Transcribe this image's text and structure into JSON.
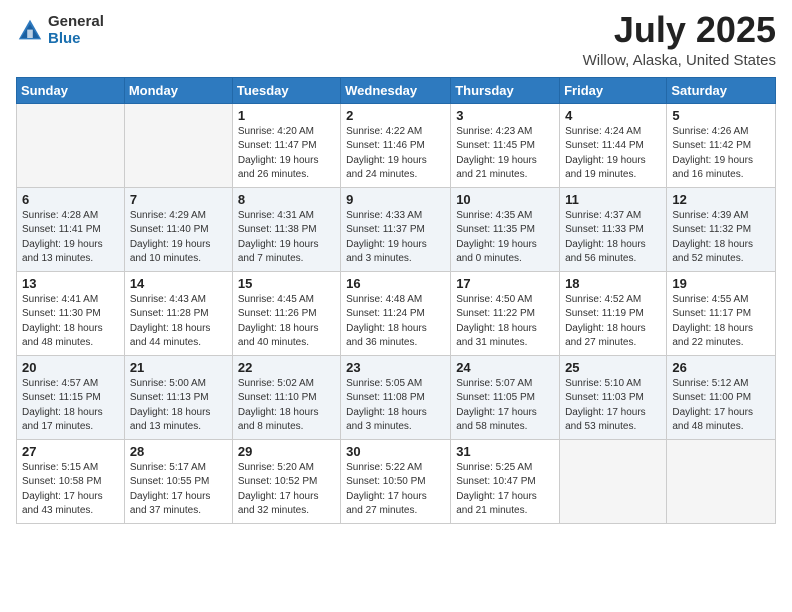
{
  "header": {
    "logo_general": "General",
    "logo_blue": "Blue",
    "title": "July 2025",
    "location": "Willow, Alaska, United States"
  },
  "days_of_week": [
    "Sunday",
    "Monday",
    "Tuesday",
    "Wednesday",
    "Thursday",
    "Friday",
    "Saturday"
  ],
  "weeks": [
    [
      {
        "num": "",
        "detail": "",
        "empty": true
      },
      {
        "num": "",
        "detail": "",
        "empty": true
      },
      {
        "num": "1",
        "detail": "Sunrise: 4:20 AM\nSunset: 11:47 PM\nDaylight: 19 hours\nand 26 minutes.",
        "empty": false
      },
      {
        "num": "2",
        "detail": "Sunrise: 4:22 AM\nSunset: 11:46 PM\nDaylight: 19 hours\nand 24 minutes.",
        "empty": false
      },
      {
        "num": "3",
        "detail": "Sunrise: 4:23 AM\nSunset: 11:45 PM\nDaylight: 19 hours\nand 21 minutes.",
        "empty": false
      },
      {
        "num": "4",
        "detail": "Sunrise: 4:24 AM\nSunset: 11:44 PM\nDaylight: 19 hours\nand 19 minutes.",
        "empty": false
      },
      {
        "num": "5",
        "detail": "Sunrise: 4:26 AM\nSunset: 11:42 PM\nDaylight: 19 hours\nand 16 minutes.",
        "empty": false
      }
    ],
    [
      {
        "num": "6",
        "detail": "Sunrise: 4:28 AM\nSunset: 11:41 PM\nDaylight: 19 hours\nand 13 minutes.",
        "empty": false
      },
      {
        "num": "7",
        "detail": "Sunrise: 4:29 AM\nSunset: 11:40 PM\nDaylight: 19 hours\nand 10 minutes.",
        "empty": false
      },
      {
        "num": "8",
        "detail": "Sunrise: 4:31 AM\nSunset: 11:38 PM\nDaylight: 19 hours\nand 7 minutes.",
        "empty": false
      },
      {
        "num": "9",
        "detail": "Sunrise: 4:33 AM\nSunset: 11:37 PM\nDaylight: 19 hours\nand 3 minutes.",
        "empty": false
      },
      {
        "num": "10",
        "detail": "Sunrise: 4:35 AM\nSunset: 11:35 PM\nDaylight: 19 hours\nand 0 minutes.",
        "empty": false
      },
      {
        "num": "11",
        "detail": "Sunrise: 4:37 AM\nSunset: 11:33 PM\nDaylight: 18 hours\nand 56 minutes.",
        "empty": false
      },
      {
        "num": "12",
        "detail": "Sunrise: 4:39 AM\nSunset: 11:32 PM\nDaylight: 18 hours\nand 52 minutes.",
        "empty": false
      }
    ],
    [
      {
        "num": "13",
        "detail": "Sunrise: 4:41 AM\nSunset: 11:30 PM\nDaylight: 18 hours\nand 48 minutes.",
        "empty": false
      },
      {
        "num": "14",
        "detail": "Sunrise: 4:43 AM\nSunset: 11:28 PM\nDaylight: 18 hours\nand 44 minutes.",
        "empty": false
      },
      {
        "num": "15",
        "detail": "Sunrise: 4:45 AM\nSunset: 11:26 PM\nDaylight: 18 hours\nand 40 minutes.",
        "empty": false
      },
      {
        "num": "16",
        "detail": "Sunrise: 4:48 AM\nSunset: 11:24 PM\nDaylight: 18 hours\nand 36 minutes.",
        "empty": false
      },
      {
        "num": "17",
        "detail": "Sunrise: 4:50 AM\nSunset: 11:22 PM\nDaylight: 18 hours\nand 31 minutes.",
        "empty": false
      },
      {
        "num": "18",
        "detail": "Sunrise: 4:52 AM\nSunset: 11:19 PM\nDaylight: 18 hours\nand 27 minutes.",
        "empty": false
      },
      {
        "num": "19",
        "detail": "Sunrise: 4:55 AM\nSunset: 11:17 PM\nDaylight: 18 hours\nand 22 minutes.",
        "empty": false
      }
    ],
    [
      {
        "num": "20",
        "detail": "Sunrise: 4:57 AM\nSunset: 11:15 PM\nDaylight: 18 hours\nand 17 minutes.",
        "empty": false
      },
      {
        "num": "21",
        "detail": "Sunrise: 5:00 AM\nSunset: 11:13 PM\nDaylight: 18 hours\nand 13 minutes.",
        "empty": false
      },
      {
        "num": "22",
        "detail": "Sunrise: 5:02 AM\nSunset: 11:10 PM\nDaylight: 18 hours\nand 8 minutes.",
        "empty": false
      },
      {
        "num": "23",
        "detail": "Sunrise: 5:05 AM\nSunset: 11:08 PM\nDaylight: 18 hours\nand 3 minutes.",
        "empty": false
      },
      {
        "num": "24",
        "detail": "Sunrise: 5:07 AM\nSunset: 11:05 PM\nDaylight: 17 hours\nand 58 minutes.",
        "empty": false
      },
      {
        "num": "25",
        "detail": "Sunrise: 5:10 AM\nSunset: 11:03 PM\nDaylight: 17 hours\nand 53 minutes.",
        "empty": false
      },
      {
        "num": "26",
        "detail": "Sunrise: 5:12 AM\nSunset: 11:00 PM\nDaylight: 17 hours\nand 48 minutes.",
        "empty": false
      }
    ],
    [
      {
        "num": "27",
        "detail": "Sunrise: 5:15 AM\nSunset: 10:58 PM\nDaylight: 17 hours\nand 43 minutes.",
        "empty": false
      },
      {
        "num": "28",
        "detail": "Sunrise: 5:17 AM\nSunset: 10:55 PM\nDaylight: 17 hours\nand 37 minutes.",
        "empty": false
      },
      {
        "num": "29",
        "detail": "Sunrise: 5:20 AM\nSunset: 10:52 PM\nDaylight: 17 hours\nand 32 minutes.",
        "empty": false
      },
      {
        "num": "30",
        "detail": "Sunrise: 5:22 AM\nSunset: 10:50 PM\nDaylight: 17 hours\nand 27 minutes.",
        "empty": false
      },
      {
        "num": "31",
        "detail": "Sunrise: 5:25 AM\nSunset: 10:47 PM\nDaylight: 17 hours\nand 21 minutes.",
        "empty": false
      },
      {
        "num": "",
        "detail": "",
        "empty": true
      },
      {
        "num": "",
        "detail": "",
        "empty": true
      }
    ]
  ]
}
